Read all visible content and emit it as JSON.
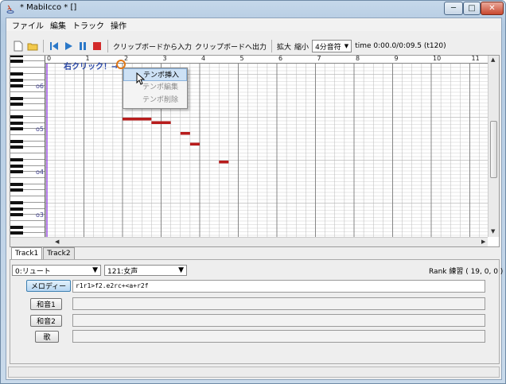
{
  "window": {
    "title": "* MabiIcco * []",
    "controls": {
      "minimize": "─",
      "maximize": "□",
      "close": "✕"
    }
  },
  "menubar": [
    "ファイル",
    "編集",
    "トラック",
    "操作"
  ],
  "toolbar": {
    "clip_import": "クリップボードから入力",
    "clip_export": "クリップボードへ出力",
    "zoom_in": "拡大",
    "zoom_out": "縮小",
    "note_length": "4分音符",
    "time": "time 0:00.0/0:09.5 (t120)"
  },
  "ruler": [
    "0",
    "1",
    "2",
    "3",
    "4",
    "5",
    "6",
    "7",
    "8",
    "9",
    "10",
    "11"
  ],
  "octaves": [
    "o6",
    "o5",
    "o4",
    "o3"
  ],
  "annotation": "右クリック！→",
  "context_menu": [
    "テンポ挿入",
    "テンポ編集",
    "テンポ削除"
  ],
  "tabs": [
    "Track1",
    "Track2"
  ],
  "track": {
    "instrument": "0:リュート",
    "voice": "121:女声",
    "rank": "Rank 練習 ( 19, 0, 0 )",
    "rows": [
      {
        "label": "メロディー",
        "value": "r1r1>f2.e2rc+<a+r2f"
      },
      {
        "label": "和音1",
        "value": ""
      },
      {
        "label": "和音2",
        "value": ""
      },
      {
        "label": "歌",
        "value": ""
      }
    ]
  },
  "colors": {
    "note": "#b81c1c",
    "grid_light": "#e4e4e4",
    "grid_dark": "#c8c8c8",
    "accent": "#e07818"
  }
}
